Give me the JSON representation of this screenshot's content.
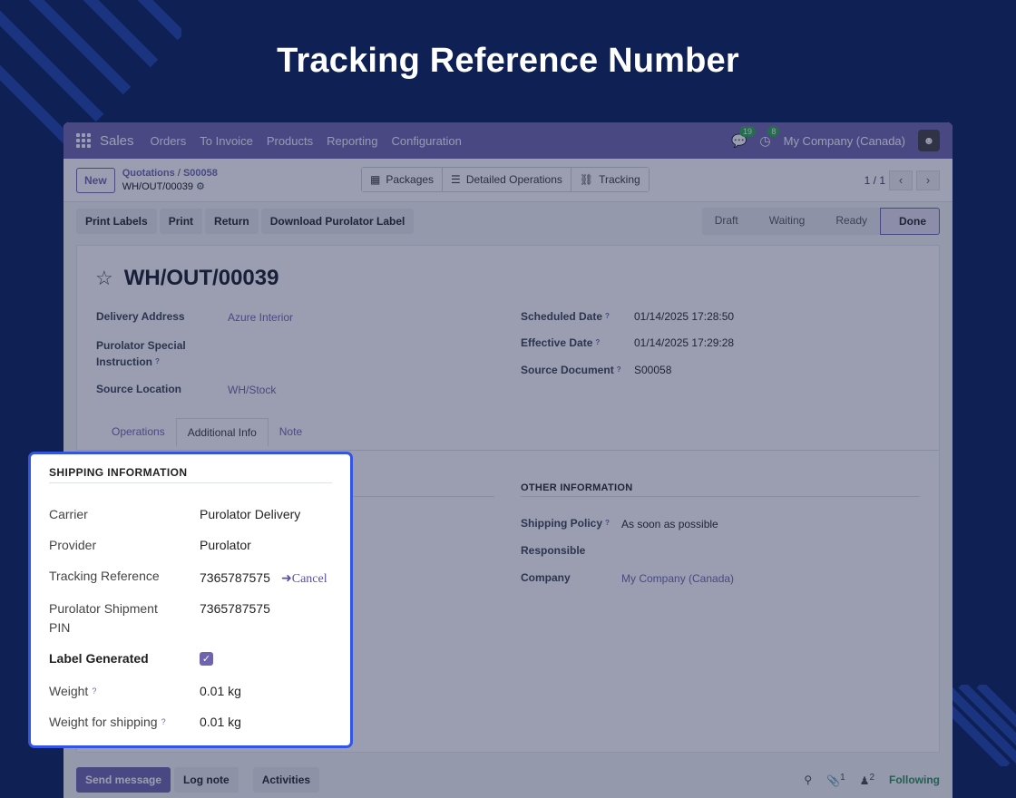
{
  "banner": {
    "title": "Tracking Reference Number"
  },
  "navbar": {
    "brand": "Sales",
    "items": [
      "Orders",
      "To Invoice",
      "Products",
      "Reporting",
      "Configuration"
    ],
    "messages_count": "19",
    "activities_count": "8",
    "company": "My Company (Canada)"
  },
  "control_panel": {
    "new_label": "New",
    "breadcrumb_parent": "Quotations",
    "breadcrumb_sep": "/",
    "breadcrumb_order": "S00058",
    "breadcrumb_current": "WH/OUT/00039",
    "smart_buttons": [
      "Packages",
      "Detailed Operations",
      "Tracking"
    ],
    "pager": "1 / 1"
  },
  "action_bar": {
    "buttons": [
      "Print Labels",
      "Print",
      "Return",
      "Download Purolator Label"
    ],
    "statuses": [
      "Draft",
      "Waiting",
      "Ready",
      "Done"
    ]
  },
  "record": {
    "name": "WH/OUT/00039",
    "delivery_address_label": "Delivery Address",
    "delivery_address": "Azure Interior",
    "special_instruction_label": "Purolator Special Instruction",
    "source_location_label": "Source Location",
    "source_location": "WH/Stock",
    "scheduled_date_label": "Scheduled Date",
    "scheduled_date": "01/14/2025 17:28:50",
    "effective_date_label": "Effective Date",
    "effective_date": "01/14/2025 17:29:28",
    "source_document_label": "Source Document",
    "source_document": "S00058"
  },
  "tabs": [
    "Operations",
    "Additional Info",
    "Note"
  ],
  "other_info": {
    "title": "OTHER INFORMATION",
    "shipping_policy_label": "Shipping Policy",
    "shipping_policy": "As soon as possible",
    "responsible_label": "Responsible",
    "company_label": "Company",
    "company": "My Company (Canada)"
  },
  "chatter": {
    "send_message": "Send message",
    "log_note": "Log note",
    "activities": "Activities",
    "attachments_count": "1",
    "followers_count": "2",
    "following": "Following"
  },
  "shipping": {
    "title": "SHIPPING INFORMATION",
    "carrier_label": "Carrier",
    "carrier": "Purolator Delivery",
    "provider_label": "Provider",
    "provider": "Purolator",
    "tracking_label": "Tracking Reference",
    "tracking": "7365787575",
    "cancel_label": "Cancel",
    "pin_label": "Purolator Shipment PIN",
    "pin": "7365787575",
    "label_generated_label": "Label Generated",
    "label_generated": true,
    "weight_label": "Weight",
    "weight": "0.01 kg",
    "weight_shipping_label": "Weight for shipping",
    "weight_shipping": "0.01 kg"
  },
  "colors": {
    "accent": "#6e63ad",
    "highlight_border": "#3454e3",
    "background": "#0f2055"
  }
}
